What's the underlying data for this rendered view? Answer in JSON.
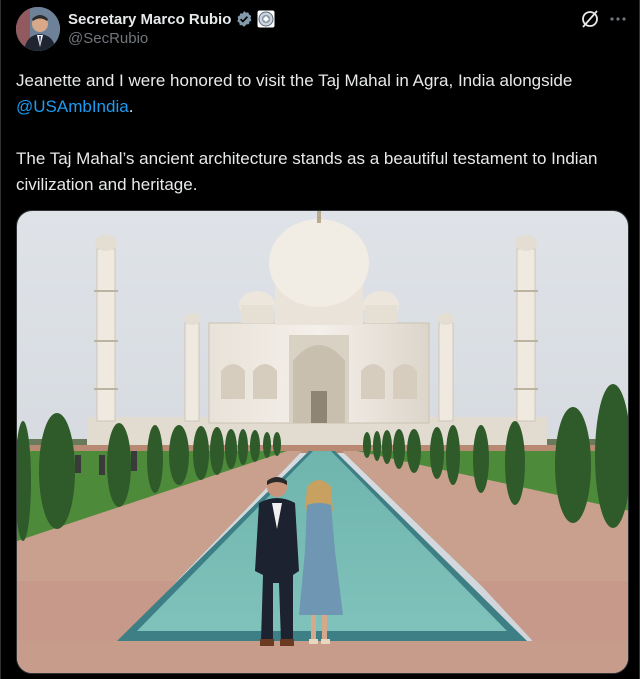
{
  "author": {
    "display_name": "Secretary Marco Rubio",
    "handle": "@SecRubio",
    "verified_badge": "verified-check-icon",
    "affiliation_badge": "us-government-seal-icon"
  },
  "actions": {
    "grok_icon": "grok-icon",
    "more_icon": "more-options-icon"
  },
  "tweet": {
    "line1_before": "Jeanette and I were honored to visit the Taj Mahal in Agra, India alongside ",
    "mention": "@USAmbIndia",
    "line1_after": ".",
    "paragraph2": "The Taj Mahal’s ancient architecture stands as a beautiful testament to Indian civilization and heritage."
  },
  "media": {
    "kind": "photo",
    "subject": "photo-taj-mahal"
  },
  "colors": {
    "background": "#000000",
    "text": "#e7e9ea",
    "secondary": "#71767b",
    "link": "#1d9bf0",
    "verified": "#829aab"
  }
}
